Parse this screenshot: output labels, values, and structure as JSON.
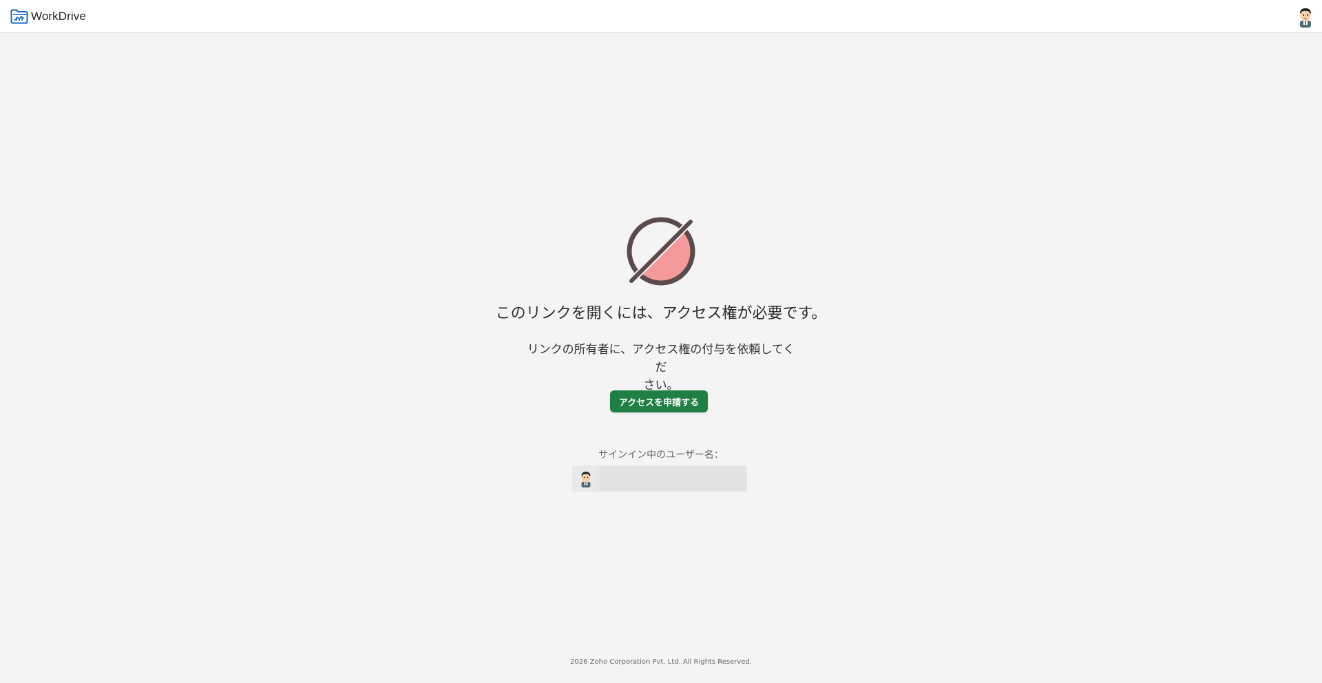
{
  "app": {
    "name": "WorkDrive",
    "logo_icon": "workdrive-folder-icon",
    "brand_color": "#1565c0"
  },
  "header": {
    "user_avatar_icon": "user-avatar-icon"
  },
  "access_denied": {
    "icon": "no-access-icon",
    "icon_colors": {
      "stroke": "#5a4a4a",
      "fill": "#f49a9a"
    },
    "title": "このリンクを開くには、アクセス権が必要です。",
    "message_line1": "リンクの所有者に、アクセス権の付与を依頼してくだ",
    "message_line2": "さい。",
    "request_button_label": "アクセスを申請する",
    "button_color": "#1f7f45",
    "signed_in_label": "サインイン中のユーザー名："
  },
  "footer": {
    "copyright": "2026 Zoho Corporation Pvt. Ltd. All Rights Reserved."
  }
}
